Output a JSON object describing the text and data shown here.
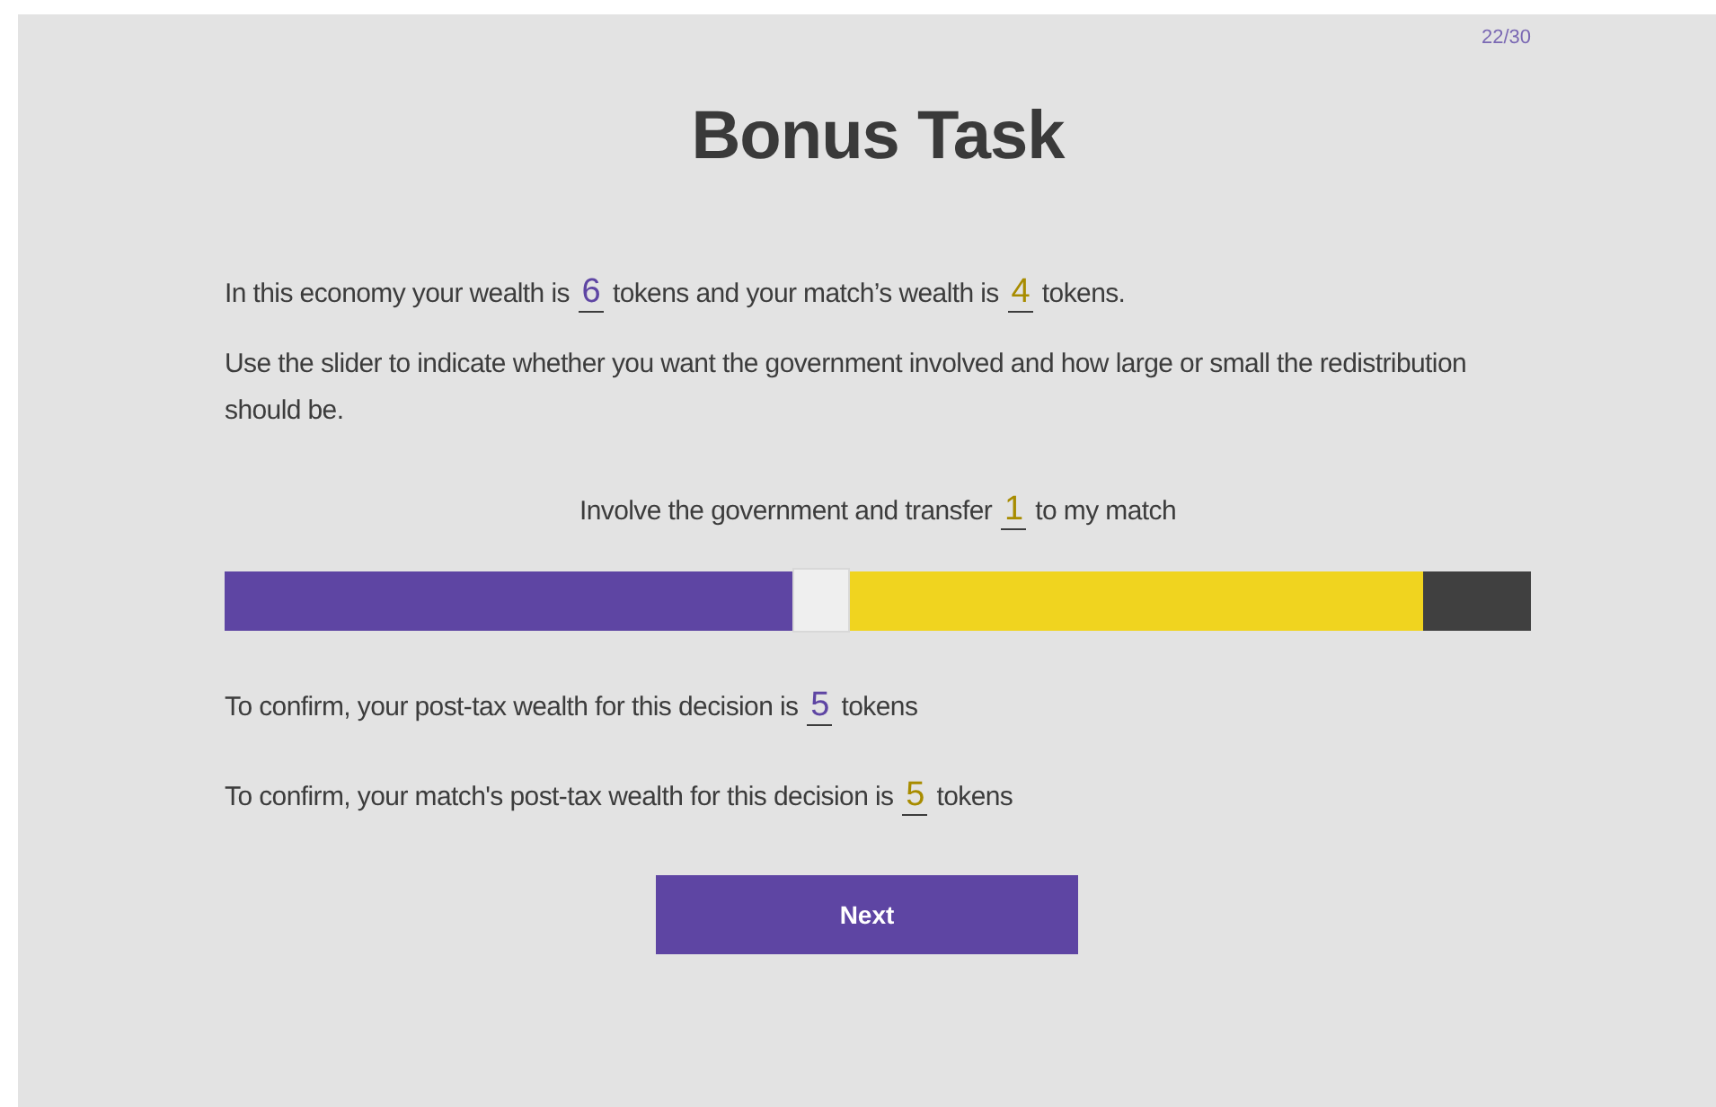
{
  "progress": "22/30",
  "title": "Bonus Task",
  "intro": [
    {
      "parts": [
        "In this economy your wealth is ",
        {
          "value": "6",
          "color": "#5e45a3"
        },
        " tokens and your match’s wealth is ",
        {
          "value": "4",
          "color": "#a88c00"
        },
        " tokens."
      ]
    },
    {
      "parts": [
        "Use the slider to indicate whether you want the government involved and how large or small the redistribution should be."
      ]
    }
  ],
  "slider_caption": {
    "parts": [
      "Involve the government and transfer ",
      {
        "value": "1",
        "color": "#a88c00"
      },
      " to my match"
    ]
  },
  "slider": {
    "level": 0.457
  },
  "confirmations": [
    {
      "parts": [
        "To confirm, your post-tax wealth for this decision is ",
        {
          "value": "5",
          "color": "#5e45a3"
        },
        " tokens"
      ]
    },
    {
      "parts": [
        "To confirm, your match's post-tax wealth for this decision is ",
        {
          "value": "5",
          "color": "#a88c00"
        },
        " tokens"
      ]
    }
  ],
  "next_button": "Next"
}
